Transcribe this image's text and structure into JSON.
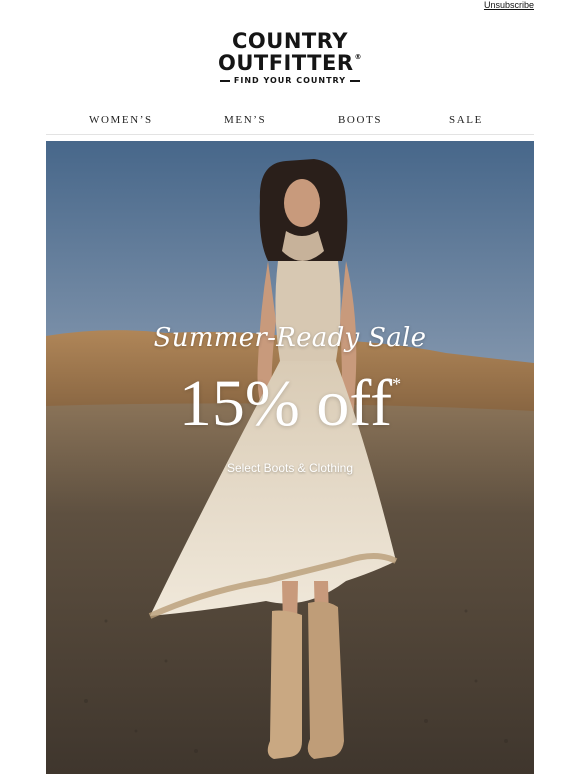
{
  "header": {
    "unsubscribe_label": "Unsubscribe"
  },
  "logo": {
    "line1": "COUNTRY",
    "line2": "OUTFITTER",
    "registered_mark": "®",
    "tagline": "FIND YOUR COUNTRY"
  },
  "nav": {
    "items": [
      {
        "label": "WOMEN’S"
      },
      {
        "label": "MEN’S"
      },
      {
        "label": "BOOTS"
      },
      {
        "label": "SALE"
      }
    ]
  },
  "hero": {
    "script_title": "Summer-Ready Sale",
    "offer": "15% off",
    "offer_asterisk": "*",
    "sub_offer": "Select Boots & Clothing",
    "colors": {
      "sky": "#5b7899",
      "hills": "#a07a4c",
      "ground": "#5a4c3e",
      "dress": "#e8ddcb",
      "boots": "#c9a882"
    }
  }
}
